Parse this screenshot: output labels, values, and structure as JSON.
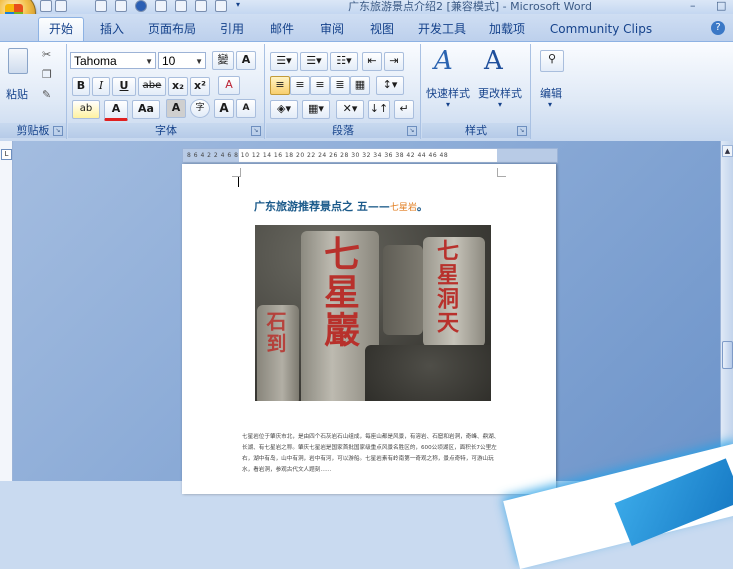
{
  "window": {
    "title": "广东旅游景点介绍2 [兼容模式] - Microsoft Word",
    "controls": [
      "–",
      "□"
    ]
  },
  "tabs": [
    {
      "label": "开始",
      "active": true
    },
    {
      "label": "插入"
    },
    {
      "label": "页面布局"
    },
    {
      "label": "引用"
    },
    {
      "label": "邮件"
    },
    {
      "label": "审阅"
    },
    {
      "label": "视图"
    },
    {
      "label": "开发工具"
    },
    {
      "label": "加载项"
    },
    {
      "label": "Community Clips"
    }
  ],
  "ribbon": {
    "clipboard": {
      "label": "剪贴板",
      "paste_label": "粘贴",
      "launcher": "↘"
    },
    "font": {
      "label": "字体",
      "font_name": "Tahoma",
      "font_size": "10",
      "phonetic_guide": "變",
      "char_border": "A",
      "bold": "B",
      "italic": "I",
      "underline": "U",
      "strikethrough": "abe",
      "subscript": "x₂",
      "superscript": "x²",
      "clear_format": "A",
      "highlight": "ab",
      "font_color": "A",
      "change_case": "Aa",
      "char_shading": "A",
      "enclose_char": "字",
      "grow": "A",
      "shrink": "A",
      "launcher": "↘"
    },
    "paragraph": {
      "label": "段落",
      "launcher": "↘"
    },
    "styles": {
      "label": "样式",
      "quick_styles": "快速样式",
      "change_styles": "更改样式",
      "launcher": "↘"
    },
    "editing": {
      "label": "编辑"
    }
  },
  "ruler": {
    "numbers": "8  6  4  2     2  4  6  8  10  12  14  16  18  20  22  24  26  28  30  32  34  36  38     42  44  46  48"
  },
  "document": {
    "heading": "广东旅游推荐景点之 五——",
    "heading_highlight": "七星岩",
    "heading_end": "。",
    "photo_inscriptions": {
      "center": "七星巖",
      "right": "七星洞天",
      "left": "石到"
    },
    "body_text": "七星岩位于肇庆市北，是由四个石灰岩石山组成，每座山都是风景，有溶岩、石窟和岩洞，奇峰、鼎湖、长湖、有七星岩之称。肇庆七星岩是国家首批国家级重点风景名胜区的，600公顷湖区，面积长7公里左右，湖中有岛，山中有洞，岩中有河，可以游船。七星岩素有岭南第一奇观之称，景点奇特，可游山玩水，看岩洞，参观古代文人题刻……"
  },
  "colors": {
    "ribbon_border": "#8db2e3",
    "heading_color": "#1b5a8a",
    "highlight_color": "#e07a1a",
    "inscription_red": "#b8312c"
  }
}
